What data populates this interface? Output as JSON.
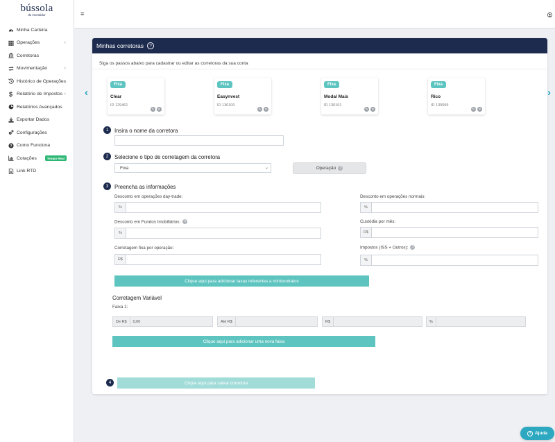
{
  "brand": {
    "logo_main": "bússola",
    "logo_sub": "do investidor"
  },
  "sidebar": {
    "items": [
      {
        "label": "Minha Carteira",
        "icon": "dashboard-icon",
        "chevron": ""
      },
      {
        "label": "Operações",
        "icon": "grid-icon",
        "chevron": "‹"
      },
      {
        "label": "Corretoras",
        "icon": "bank-icon",
        "chevron": ""
      },
      {
        "label": "Movimentação",
        "icon": "exchange-icon",
        "chevron": "‹"
      },
      {
        "label": "Histórico de Operações",
        "icon": "history-icon",
        "chevron": ""
      },
      {
        "label": "Relatório de Impostos",
        "icon": "dollar-icon",
        "chevron": "‹"
      },
      {
        "label": "Relatórios Avançados",
        "icon": "pie-chart-icon",
        "chevron": ""
      },
      {
        "label": "Exportar Dados",
        "icon": "download-icon",
        "chevron": ""
      },
      {
        "label": "Configurações",
        "icon": "cogs-icon",
        "chevron": ""
      },
      {
        "label": "Como Funciona",
        "icon": "question-icon",
        "chevron": ""
      },
      {
        "label": "Cotações",
        "icon": "bar-chart-icon",
        "chevron": "",
        "badge": "Tempo Real"
      },
      {
        "label": "Link RTD",
        "icon": "file-excel-icon",
        "chevron": ""
      }
    ]
  },
  "card": {
    "title": "Minhas corretoras",
    "help_glyph": "?",
    "intro": "Siga os passos abaixo para cadastrar ou editar as corretoras da sua conta"
  },
  "brokers": [
    {
      "badge": "Fixa",
      "name": "Clear",
      "id": "ID 129461"
    },
    {
      "badge": "Fixa",
      "name": "Easynvest",
      "id": "ID 130100"
    },
    {
      "badge": "Fixa",
      "name": "Modal Mais",
      "id": "ID 130101"
    },
    {
      "badge": "Fixa",
      "name": "Rico",
      "id": "ID 130099"
    }
  ],
  "nav_arrows": {
    "prev": "‹",
    "next": "›"
  },
  "steps": {
    "s1": {
      "num": "1",
      "title": "Insira o nome da corretora",
      "value": ""
    },
    "s2": {
      "num": "2",
      "title": "Selecione o tipo de corretagem da corretora",
      "select_value": "Fixa",
      "operation_button": "Operação"
    },
    "s3": {
      "num": "3",
      "title": "Preencha as informações"
    },
    "s4": {
      "num": "4",
      "save_button": "Clique aqui para salvar corretora"
    }
  },
  "fields": {
    "daytrade": {
      "label": "Desconto em operações day-trade:",
      "prefix": "%"
    },
    "normais": {
      "label": "Desconto em operações normais:",
      "prefix": "%"
    },
    "fii": {
      "label": "Desconto em Fundos Imobiliários:",
      "prefix": "%"
    },
    "custodia": {
      "label": "Custódia por mês:",
      "prefix": "R$"
    },
    "fixa_op": {
      "label": "Corretagem fixa por operação:",
      "prefix": "R$"
    },
    "impostos": {
      "label": "Impostos (ISS + Outros):",
      "prefix": "%"
    }
  },
  "mini_button": "Clique aqui para adicionar taxas referentes a minicontratos",
  "variavel": {
    "title": "Corretagem Variável",
    "faixa_label": "Faixa 1:",
    "de_prefix": "De R$",
    "de_value": "0,00",
    "ate_prefix": "Até R$",
    "rs_prefix": "R$",
    "pct_prefix": "%",
    "add_button": "Clique aqui para adicionar uma nova faixa"
  },
  "help": {
    "label": "Ajuda",
    "glyph": "?"
  },
  "colors": {
    "navy": "#1d2b4e",
    "teal": "#5dc4c0",
    "accent": "#2ca8c0",
    "green_badge": "#2bb673"
  }
}
